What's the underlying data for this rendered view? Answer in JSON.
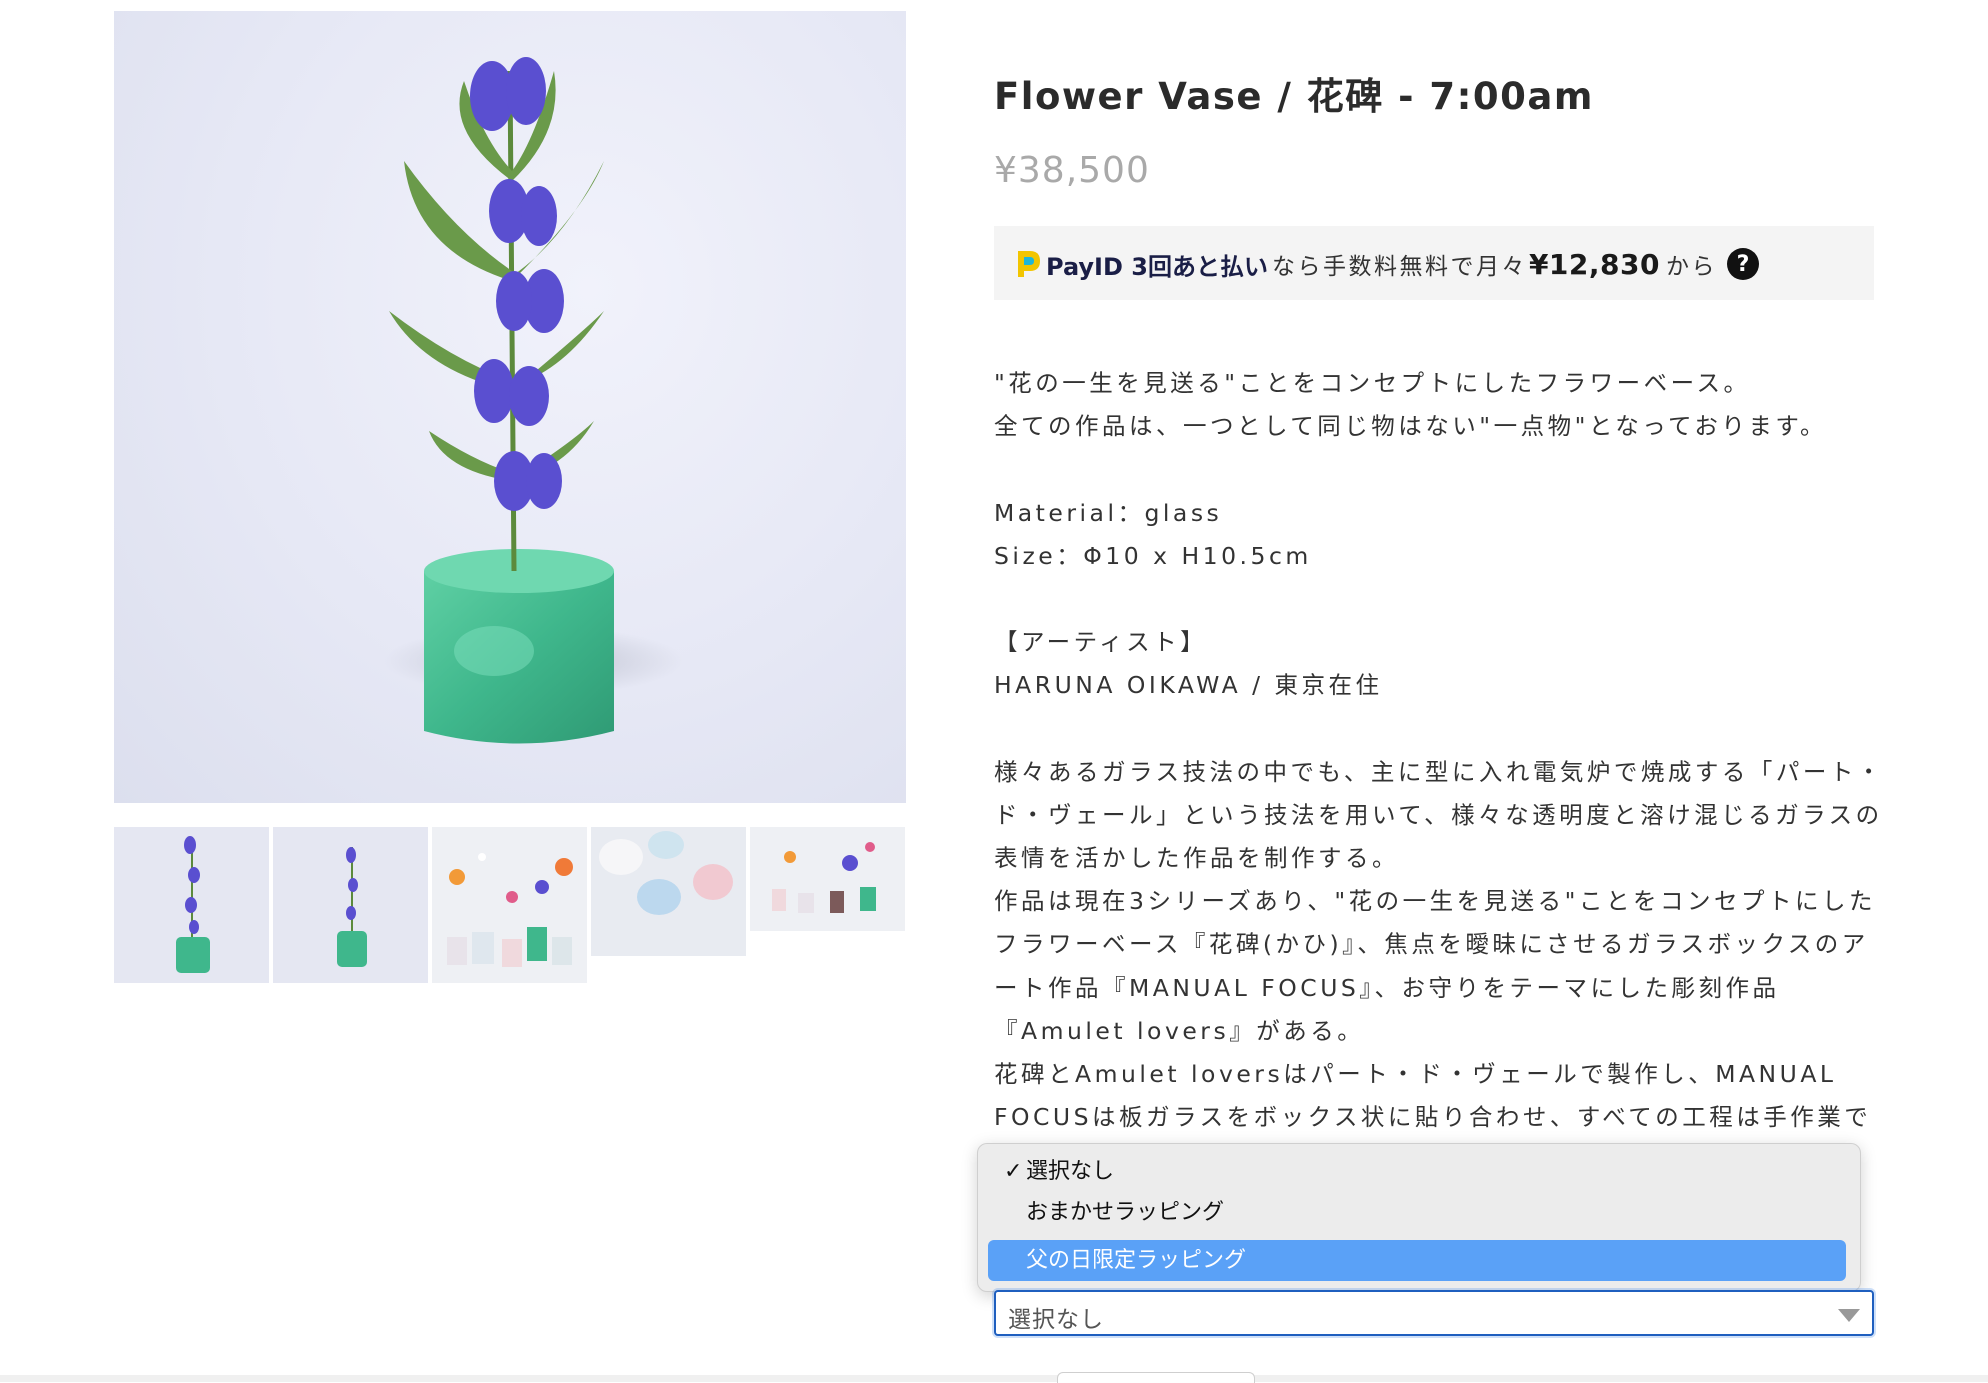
{
  "product": {
    "title": "Flower Vase / 花碑 - 7:00am",
    "price": "¥38,500"
  },
  "payid": {
    "logo_icon": "payid-logo-icon",
    "brand": "PayID 3回あと払い",
    "text_before": "なら手数料無料で月々",
    "amount": "¥12,830",
    "text_after": "から",
    "help_icon": "?"
  },
  "description": {
    "lines": [
      "\"花の一生を見送る\"ことをコンセプトにしたフラワーベース。",
      "全ての作品は、一つとして同じ物はない\"一点物\"となっております。",
      "",
      "Material：glass",
      "Size：Φ10 x H10.5cm",
      "",
      "【アーティスト】",
      "HARUNA OIKAWA / 東京在住",
      "",
      "様々あるガラス技法の中でも、主に型に入れ電気炉で焼成する「パート・",
      "ド・ヴェール」という技法を用いて、様々な透明度と溶け混じるガラスの",
      "表情を活かした作品を制作する。",
      "作品は現在3シリーズあり、\"花の一生を見送る\"ことをコンセプトにした",
      "フラワーベース『花碑(かひ)』、焦点を曖昧にさせるガラスボックスのア",
      "ート作品『MANUAL FOCUS』、お守りをテーマにした彫刻作品",
      "『Amulet lovers』がある。",
      "花碑とAmulet loversはパート・ド・ヴェールで製作し、MANUAL",
      "FOCUSは板ガラスをボックス状に貼り合わせ、すべての工程は手作業で"
    ]
  },
  "wrapping_select": {
    "current_value": "選択なし",
    "options": [
      {
        "label": "選択なし",
        "checked": true,
        "highlighted": false
      },
      {
        "label": "おまかせラッピング",
        "checked": false,
        "highlighted": false
      },
      {
        "label": "父の日限定ラッピング",
        "checked": false,
        "highlighted": true
      }
    ],
    "check_icon": "✓"
  },
  "colors": {
    "highlight": "#5aa1f7",
    "focus_border": "#1f5fbf",
    "price_gray": "#a9a9a9",
    "payid_navy": "#1a1e46",
    "vase_green": "#3fb78c",
    "flower_purple": "#5a4fd0"
  }
}
